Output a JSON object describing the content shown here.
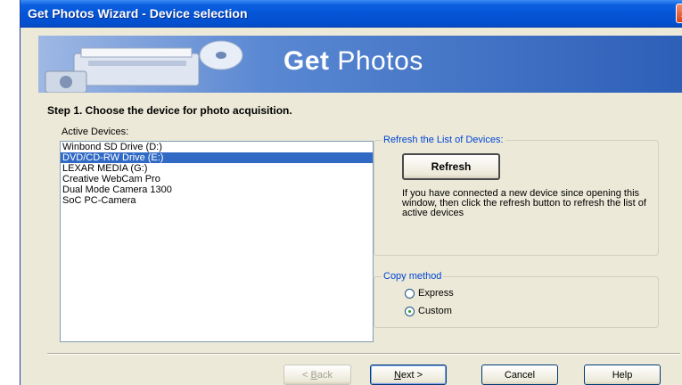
{
  "window": {
    "title": "Get Photos Wizard - Device selection"
  },
  "banner": {
    "title_strong": "Get",
    "title_rest": " Photos"
  },
  "step": {
    "text": "Step 1. Choose the device for photo acquisition."
  },
  "devices": {
    "label": "Active Devices:",
    "items": [
      {
        "label": "Winbond SD Drive (D:)",
        "selected": false
      },
      {
        "label": "DVD/CD-RW Drive (E:)",
        "selected": true
      },
      {
        "label": "LEXAR MEDIA (G:)",
        "selected": false
      },
      {
        "label": "Creative WebCam Pro",
        "selected": false
      },
      {
        "label": "Dual Mode Camera 1300",
        "selected": false
      },
      {
        "label": "SoC PC-Camera",
        "selected": false
      }
    ]
  },
  "refresh_group": {
    "legend": "Refresh the List of Devices:",
    "button_label": "Refresh",
    "description": "If you have connected a new device since opening this window, then click the refresh button to refresh the list of active devices"
  },
  "copy_group": {
    "legend": "Copy method",
    "options": [
      {
        "label": "Express",
        "checked": false
      },
      {
        "label": "Custom",
        "checked": true
      }
    ]
  },
  "footer": {
    "back_prefix": "< ",
    "back_underlined": "B",
    "back_rest": "ack",
    "next_underlined": "N",
    "next_rest": "ext >",
    "cancel_label": "Cancel",
    "help_label": "Help"
  },
  "colors": {
    "titlebar": "#0455d6",
    "selection": "#316ac5",
    "group_legend": "#0046d5",
    "window_bg": "#ece9d8"
  }
}
